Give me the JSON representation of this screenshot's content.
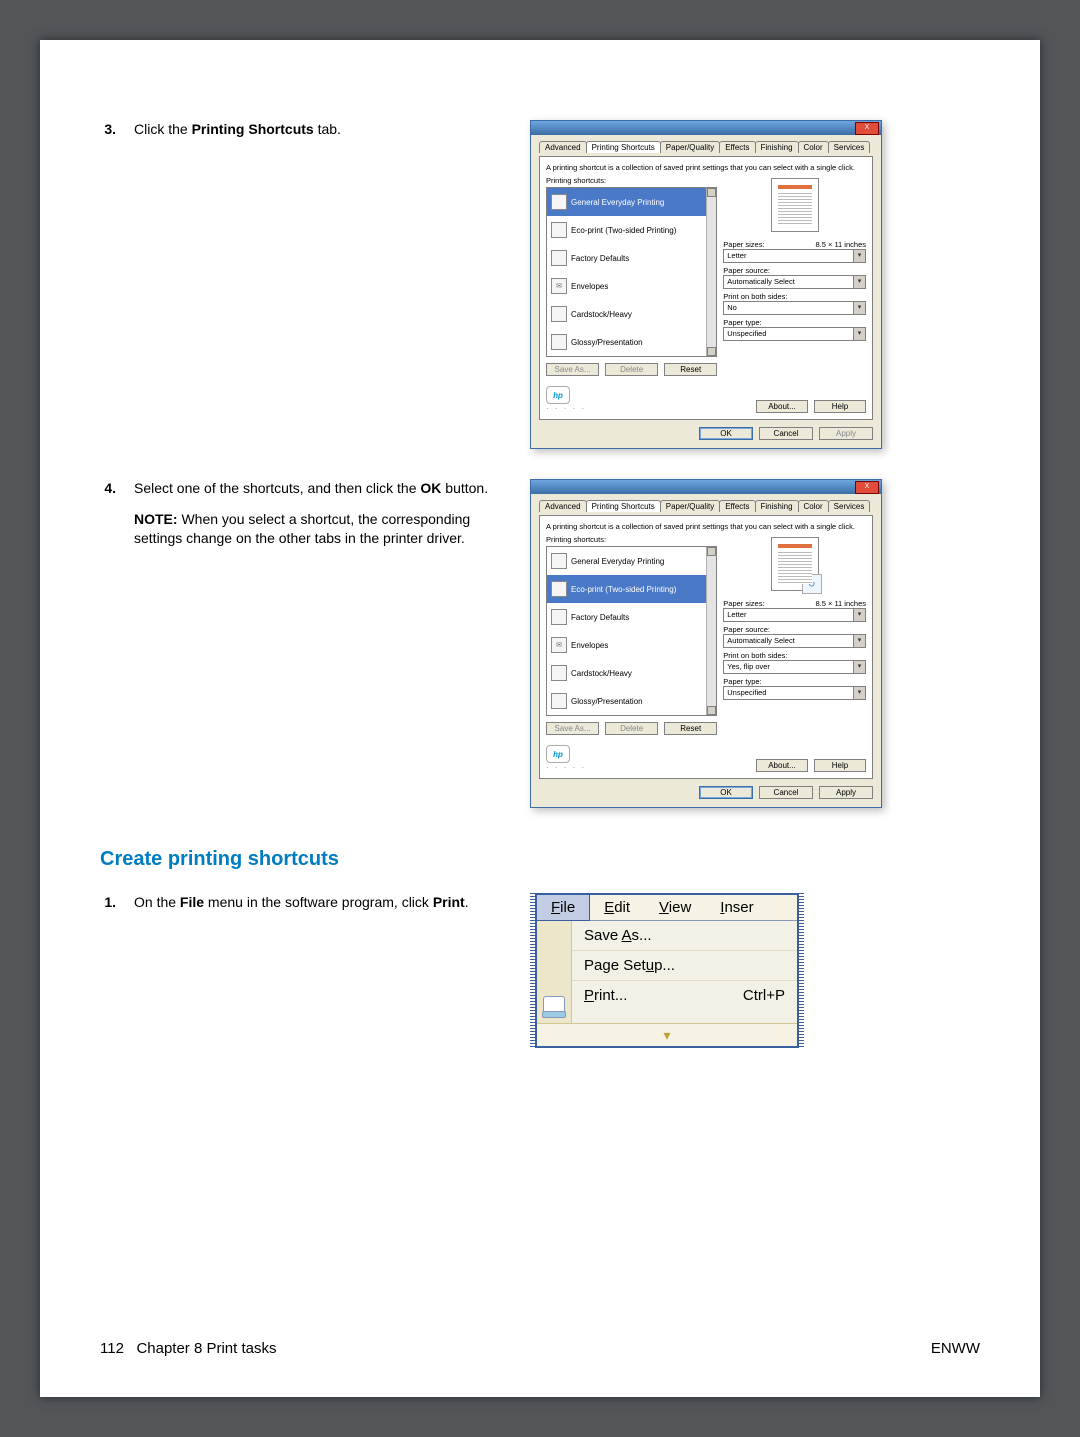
{
  "footer": {
    "left_num": "112",
    "left_label": "Chapter 8   Print tasks",
    "right": "ENWW"
  },
  "step3": {
    "num": "3.",
    "text_pre": "Click the ",
    "bold": "Printing Shortcuts",
    "text_post": " tab."
  },
  "step4": {
    "num": "4.",
    "line1_pre": "Select one of the shortcuts, and then click the ",
    "line1_bold": "OK",
    "line1_post": " button.",
    "note_prefix": "NOTE:",
    "note_body": "   When you select a shortcut, the corresponding settings change on the other tabs in the printer driver."
  },
  "subheading": "Create printing shortcuts",
  "step1": {
    "num": "1.",
    "text_pre": "On the ",
    "bold1": "File",
    "text_mid": " menu in the software program, click ",
    "bold2": "Print",
    "text_post": "."
  },
  "dialog_common": {
    "close": "X",
    "tabs": [
      "Advanced",
      "Printing Shortcuts",
      "Paper/Quality",
      "Effects",
      "Finishing",
      "Color",
      "Services"
    ],
    "desc": "A printing shortcut is a collection of saved print settings that you can select with a single click.",
    "list_label": "Printing shortcuts:",
    "shortcuts": [
      "General Everyday Printing",
      "Eco-print (Two-sided Printing)",
      "Factory Defaults",
      "Envelopes",
      "Cardstock/Heavy",
      "Glossy/Presentation"
    ],
    "paper_sizes_label": "Paper sizes:",
    "paper_sizes_hint": "8.5 × 11 inches",
    "paper_sizes_value": "Letter",
    "paper_source_label": "Paper source:",
    "paper_source_value": "Automatically Select",
    "both_sides_label": "Print on both sides:",
    "paper_type_label": "Paper type:",
    "paper_type_value": "Unspecified",
    "btn_saveas": "Save As...",
    "btn_delete": "Delete",
    "btn_reset": "Reset",
    "btn_about": "About...",
    "btn_help": "Help",
    "btn_ok": "OK",
    "btn_cancel": "Cancel",
    "btn_apply": "Apply",
    "hp": "hp"
  },
  "dialog1": {
    "selected_index": 0,
    "both_sides_value": "No",
    "apply_disabled": true,
    "show_flip": false
  },
  "dialog2": {
    "selected_index": 1,
    "both_sides_value": "Yes, flip over",
    "apply_disabled": false,
    "show_flip": true
  },
  "menuimg": {
    "menubar": [
      "File",
      "Edit",
      "View",
      "Inser"
    ],
    "menubar_acc_pos": [
      0,
      0,
      0,
      0
    ],
    "items": [
      {
        "label": "Save As...",
        "acc": 5,
        "shortcut": ""
      },
      {
        "label": "Page Setup...",
        "acc": 8,
        "shortcut": ""
      },
      {
        "label": "Print...",
        "acc": 0,
        "shortcut": "Ctrl+P"
      }
    ],
    "expand_glyph": "¤"
  }
}
